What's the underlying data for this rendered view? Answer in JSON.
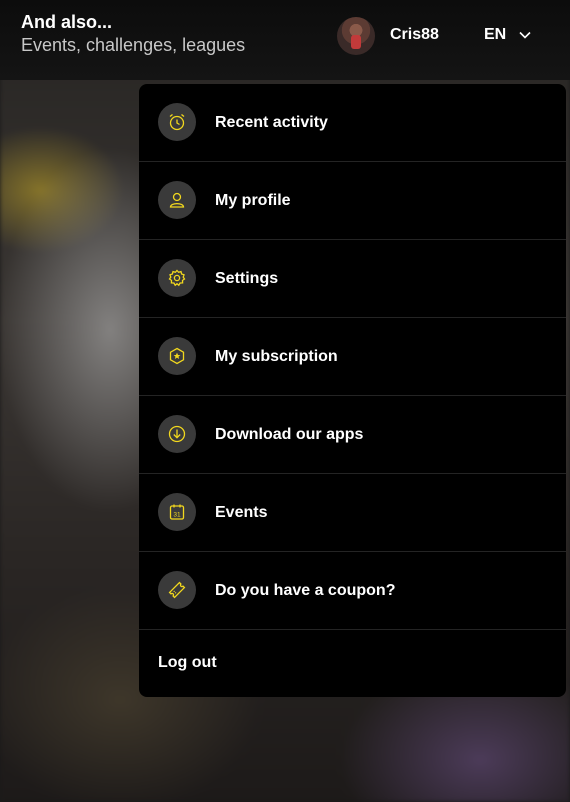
{
  "header": {
    "title": "And also...",
    "subtitle": "Events, challenges, leagues"
  },
  "user": {
    "name": "Cris88",
    "language": "EN"
  },
  "colors": {
    "accent": "#f2d81e",
    "menu_bg": "#000000",
    "icon_bg": "#3a3a3a",
    "divider": "#242424"
  },
  "menu": {
    "items": [
      {
        "label": "Recent activity",
        "icon": "alarm-clock-icon"
      },
      {
        "label": "My profile",
        "icon": "user-icon"
      },
      {
        "label": "Settings",
        "icon": "gear-icon"
      },
      {
        "label": "My subscription",
        "icon": "star-badge-icon"
      },
      {
        "label": "Download our apps",
        "icon": "download-icon"
      },
      {
        "label": "Events",
        "icon": "calendar-icon"
      },
      {
        "label": "Do you have a coupon?",
        "icon": "ticket-icon"
      }
    ],
    "logout_label": "Log out"
  }
}
